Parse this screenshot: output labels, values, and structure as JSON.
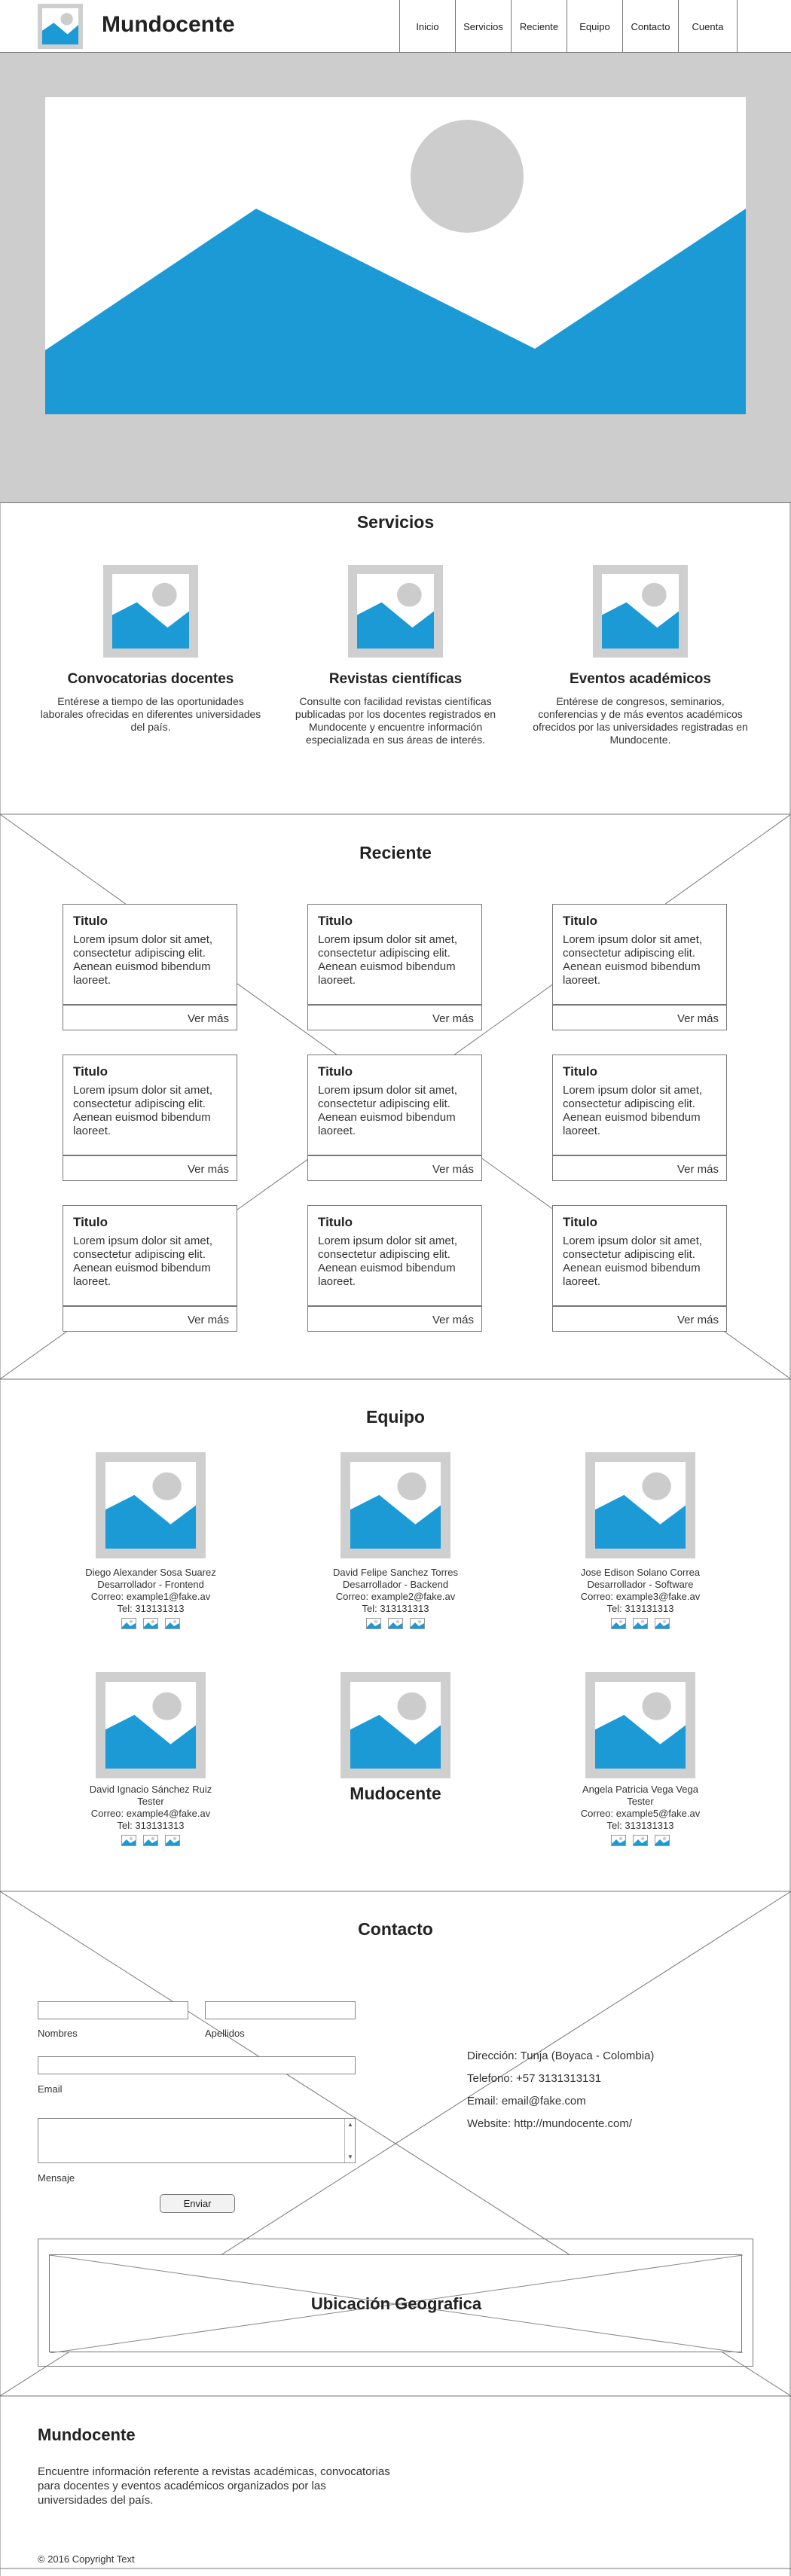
{
  "header": {
    "brand": "Mundocente",
    "nav": [
      "Inicio",
      "Servicios",
      "Reciente",
      "Equipo",
      "Contacto",
      "Cuenta"
    ]
  },
  "services": {
    "title": "Servicios",
    "items": [
      {
        "title": "Convocatorias docentes",
        "description": "Entérese a tiempo de las oportunidades laborales ofrecidas en diferentes universidades del país."
      },
      {
        "title": "Revistas científicas",
        "description": "Consulte con facilidad revistas científicas publicadas por los docentes registrados en Mundocente y encuentre información especializada en sus áreas de interés."
      },
      {
        "title": "Eventos académicos",
        "description": "Entérese de congresos, seminarios, conferencias y de más eventos académicos ofrecidos por las universidades registradas en Mundocente."
      }
    ]
  },
  "recent": {
    "title": "Reciente",
    "card": {
      "title": "Titulo",
      "body": "Lorem ipsum dolor sit amet, consectetur adipiscing elit. Aenean euismod bibendum laoreet.",
      "more": "Ver más"
    }
  },
  "team": {
    "title": "Equipo",
    "center_label": "Mudocente",
    "members": [
      {
        "name": "Diego Alexander Sosa Suarez",
        "role": "Desarrollador - Frontend",
        "email": "Correo: example1@fake.av",
        "phone": "Tel: 313131313"
      },
      {
        "name": "David Felipe Sanchez Torres",
        "role": "Desarrollador - Backend",
        "email": "Correo: example2@fake.av",
        "phone": "Tel: 313131313"
      },
      {
        "name": "Jose Edison Solano Correa",
        "role": "Desarrollador - Software",
        "email": "Correo: example3@fake.av",
        "phone": "Tel: 313131313"
      },
      {
        "name": "David Ignacio Sánchez Ruiz",
        "role": "Tester",
        "email": "Correo: example4@fake.av",
        "phone": "Tel: 313131313"
      },
      {
        "name": "Angela Patricia Vega Vega",
        "role": "Tester",
        "email": "Correo: example5@fake.av",
        "phone": "Tel: 313131313"
      }
    ]
  },
  "contact": {
    "title": "Contacto",
    "labels": {
      "first_name": "Nombres",
      "last_name": "Apellidos",
      "email": "Email",
      "message": "Mensaje"
    },
    "send": "Enviar",
    "info": [
      "Dirección: Tunja (Boyaca - Colombia)",
      "Telefono: +57 3131313131",
      "Email: email@fake.com",
      "Website: http://mundocente.com/"
    ],
    "map_label": "Ubicación Geografica"
  },
  "footer": {
    "title": "Mundocente",
    "description": "Encuentre información referente a revistas académicas, convocatorias para docentes y eventos académicos organizados por las universidades del país.",
    "copyright": "© 2016 Copyright Text"
  },
  "colors": {
    "accent": "#1b9ad6",
    "placeholder": "#cdcdcd",
    "border": "#777777"
  }
}
